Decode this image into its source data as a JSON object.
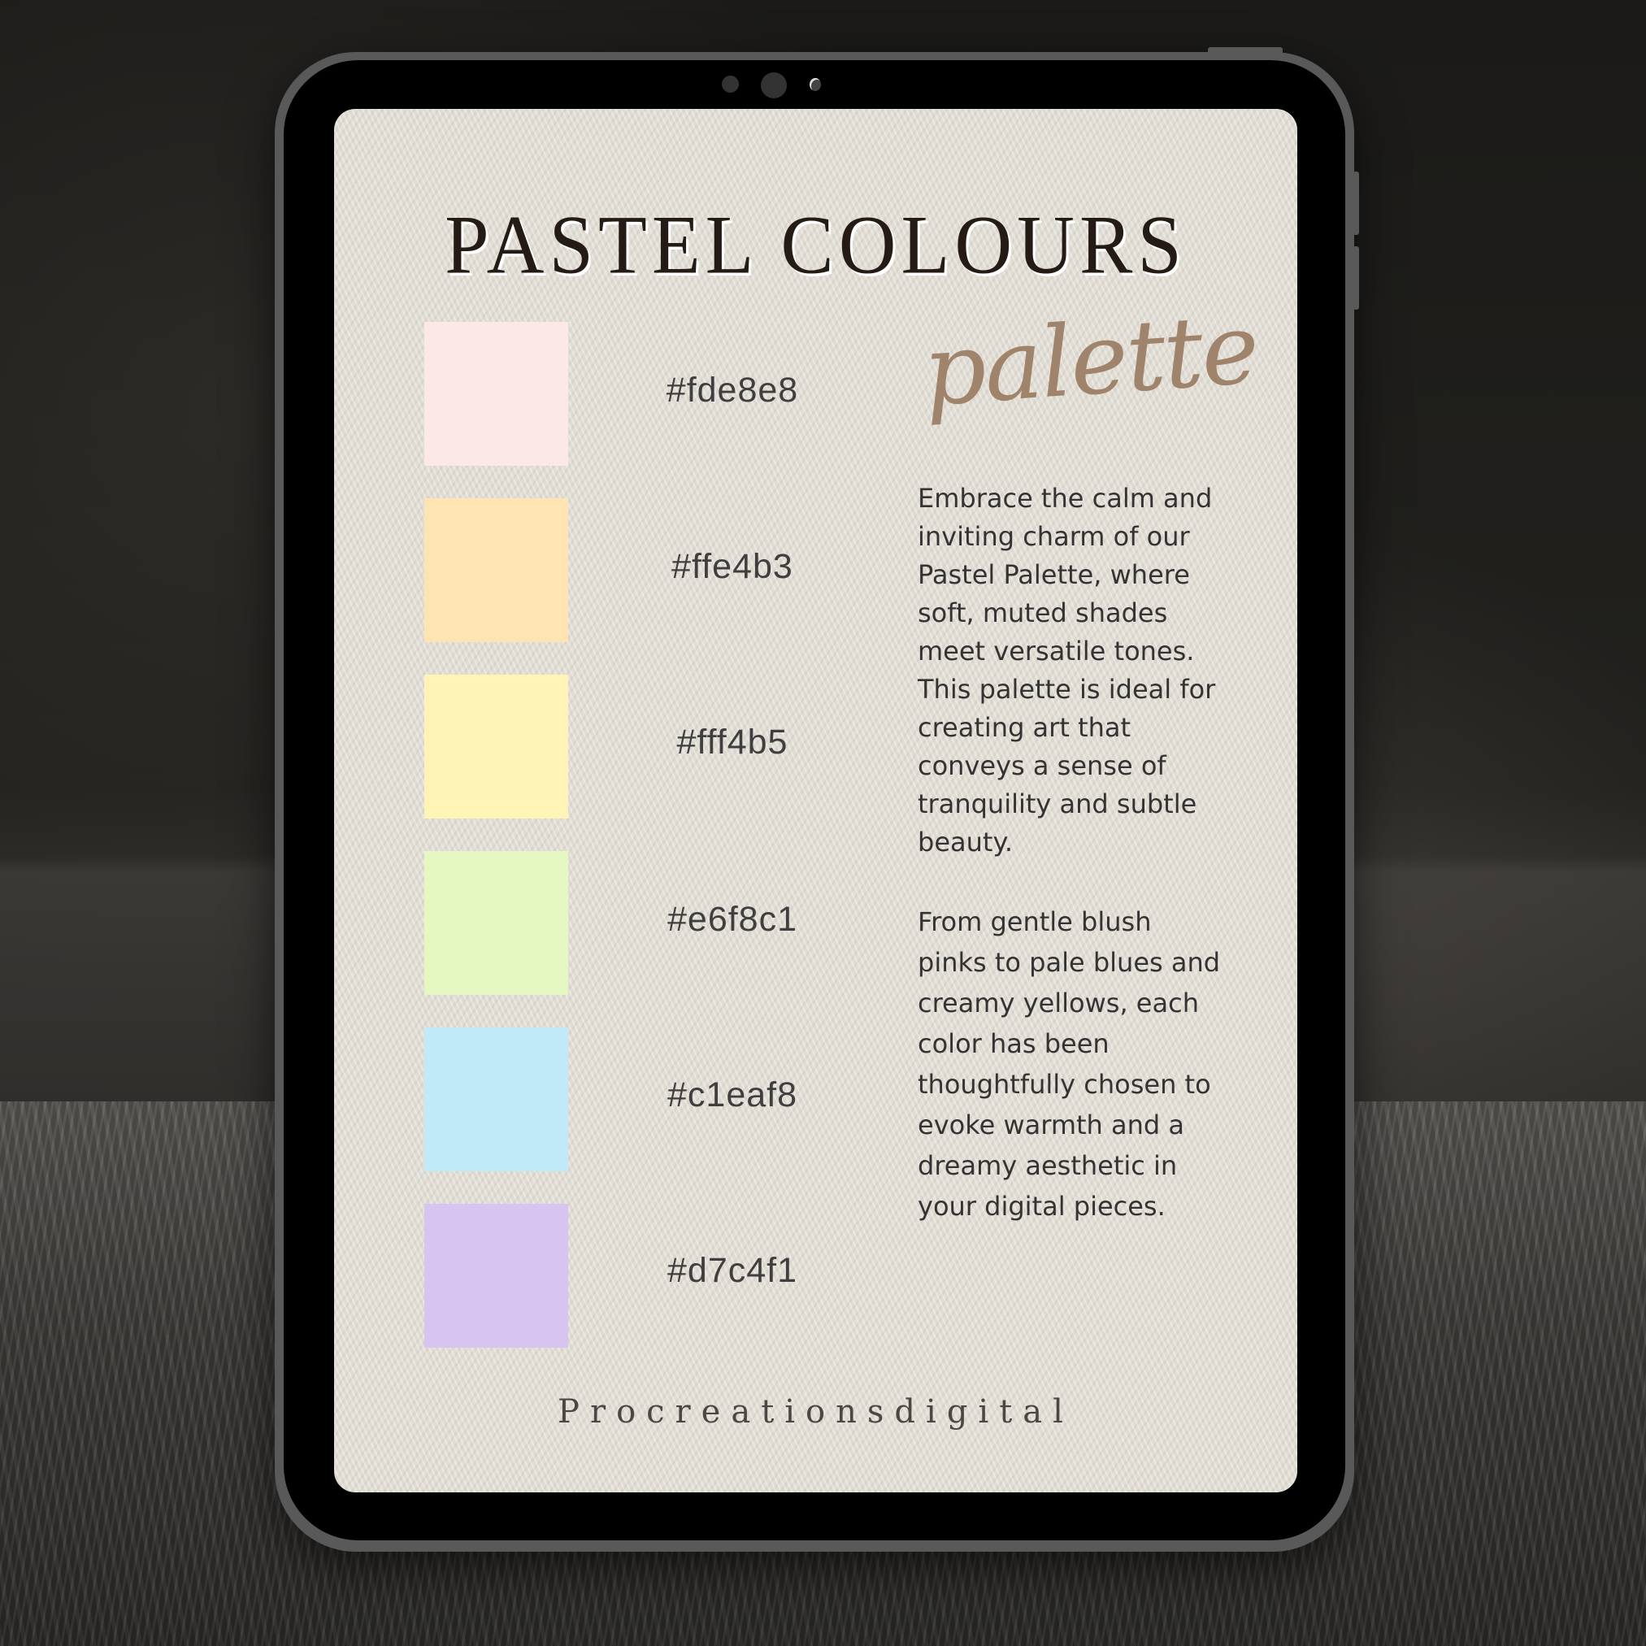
{
  "document": {
    "title": "PASTEL COLOURS",
    "subtitle_script": "palette",
    "swatches": [
      {
        "hex": "#fde8e8",
        "label": "#fde8e8"
      },
      {
        "hex": "#ffe4b3",
        "label": "#ffe4b3"
      },
      {
        "hex": "#fff4b5",
        "label": "#fff4b5"
      },
      {
        "hex": "#e6f8c1",
        "label": "#e6f8c1"
      },
      {
        "hex": "#c1eaf8",
        "label": "#c1eaf8"
      },
      {
        "hex": "#d7c4f1",
        "label": "#d7c4f1"
      }
    ],
    "paragraph_1": "Embrace the calm and inviting charm of our Pastel Palette, where soft, muted shades meet versatile tones. This palette is ideal for creating art that conveys a sense of tranquility and subtle beauty.",
    "paragraph_2": "From gentle blush pinks to pale blues and creamy yellows, each color has been thoughtfully chosen to evoke warmth and a dreamy aesthetic in your digital pieces.",
    "brand": "Procreationsdigital"
  },
  "colors": {
    "title": "#241b16",
    "script": "#a0836b",
    "body_text": "#333333",
    "paper": "#e6e2da",
    "device_frame": "#595959",
    "bezel": "#000000"
  }
}
